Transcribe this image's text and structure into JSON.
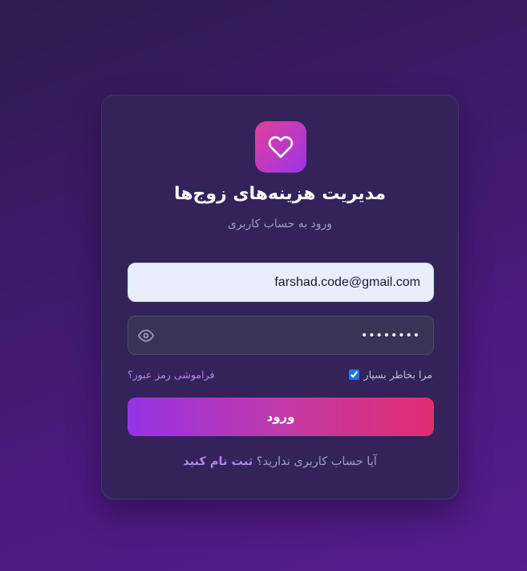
{
  "app": {
    "title": "مدیریت هزینه‌های زوج‌ها",
    "subtitle": "ورود به حساب کاربری",
    "logo_icon": "heart-icon"
  },
  "login_form": {
    "email_value": "farshad.code@gmail.com",
    "password_value": "••••••••",
    "remember_label": "مرا بخاطر بسپار",
    "remember_checked": true,
    "forgot_label": "فراموشی رمز عبور؟",
    "submit_label": "ورود",
    "signup_prompt": "آیا حساب کاربری ندارید؟",
    "signup_link": "ثبت نام کنید"
  },
  "colors": {
    "accent_purple": "#9632e6",
    "accent_pink": "#e22d72",
    "link": "#b783ec"
  }
}
